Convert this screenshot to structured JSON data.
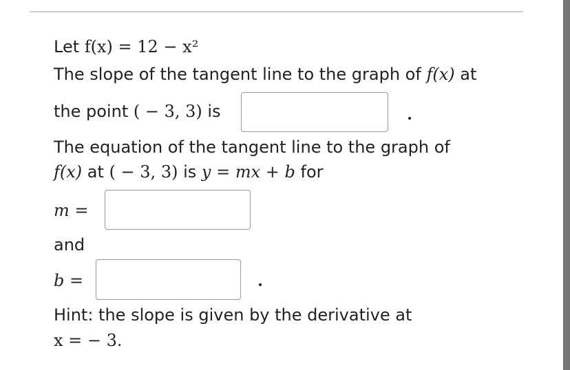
{
  "problem": {
    "let_word": "Let",
    "function_def": "f(x) = 12 − x²",
    "slope_text_1": "The slope of the tangent line to the graph of",
    "slope_fx": "f(x)",
    "slope_at": "at",
    "slope_text_2": "the point",
    "point": "( − 3, 3)",
    "is_word": "is",
    "equation_text_1": "The equation of the tangent line to the graph of",
    "eq_fx": "f(x)",
    "eq_at": "at",
    "eq_point": "( − 3, 3)",
    "eq_is": "is",
    "eq_form": "y = mx + b",
    "for_word": "for",
    "m_label": "m =",
    "and_word": "and",
    "b_label": "b =",
    "hint_text": "Hint: the slope is given by the derivative at",
    "hint_x": "x =  − 3."
  },
  "inputs": {
    "slope": "",
    "m": "",
    "b": ""
  },
  "colors": {
    "scrollbar": "#777777",
    "input_border": "#999999"
  }
}
